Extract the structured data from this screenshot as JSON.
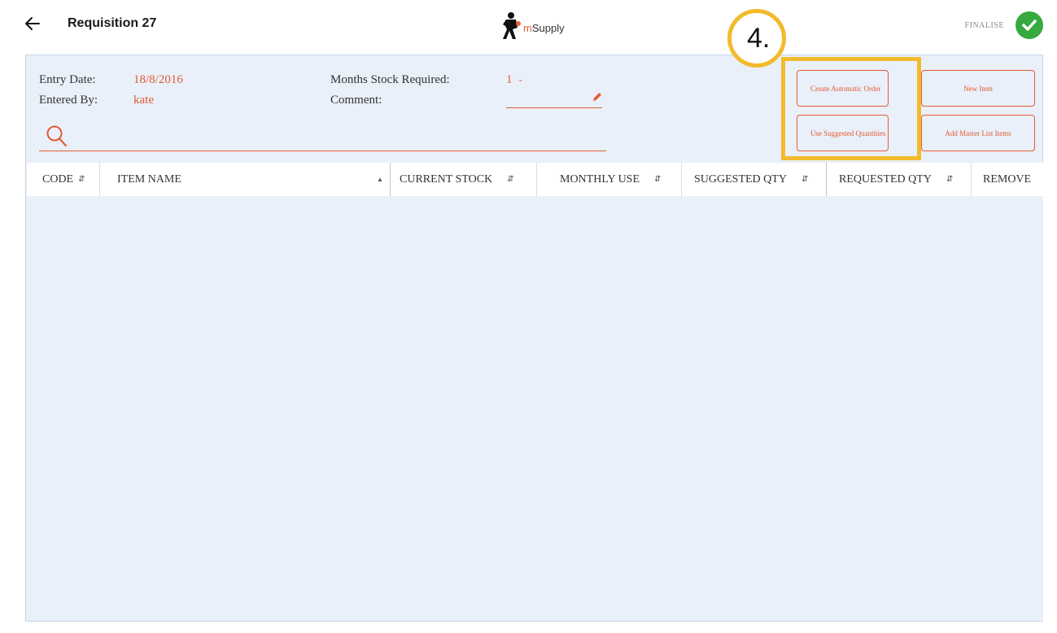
{
  "header": {
    "title": "Requisition 27",
    "logo_prefix": "m",
    "logo_suffix": "Supply",
    "finalise_label": "FINALISE"
  },
  "details": {
    "entry_date_label": "Entry Date:",
    "entry_date_value": "18/8/2016",
    "entered_by_label": "Entered By:",
    "entered_by_value": "kate",
    "months_stock_label": "Months Stock Required:",
    "months_stock_value": "1",
    "comment_label": "Comment:",
    "comment_value": ""
  },
  "search": {
    "value": ""
  },
  "actions": {
    "create_automatic_order": "Create Automatic Order",
    "use_suggested_quantities": "Use Suggested Quantities",
    "new_item": "New Item",
    "add_master_list_items": "Add Master List Items"
  },
  "annotation": {
    "step_label": "4."
  },
  "table": {
    "columns": [
      {
        "label": "CODE",
        "sort": "both"
      },
      {
        "label": "ITEM NAME",
        "sort": "asc"
      },
      {
        "label": "CURRENT STOCK",
        "sort": "both"
      },
      {
        "label": "MONTHLY USE",
        "sort": "both"
      },
      {
        "label": "SUGGESTED QTY",
        "sort": "both"
      },
      {
        "label": "REQUESTED QTY",
        "sort": "both"
      },
      {
        "label": "REMOVE",
        "sort": "none"
      }
    ],
    "rows": []
  },
  "colors": {
    "accent": "#e35a32",
    "panel_background": "#e9f0f9",
    "highlight": "#f2bb2d",
    "finalise_check": "#36a93f"
  },
  "icons": {
    "back": "arrow-left-icon",
    "logo": "runner-logo-icon",
    "finalise": "check-circle-icon",
    "comment_edit": "pencil-icon",
    "search": "search-icon",
    "sort": "sort-icon"
  }
}
